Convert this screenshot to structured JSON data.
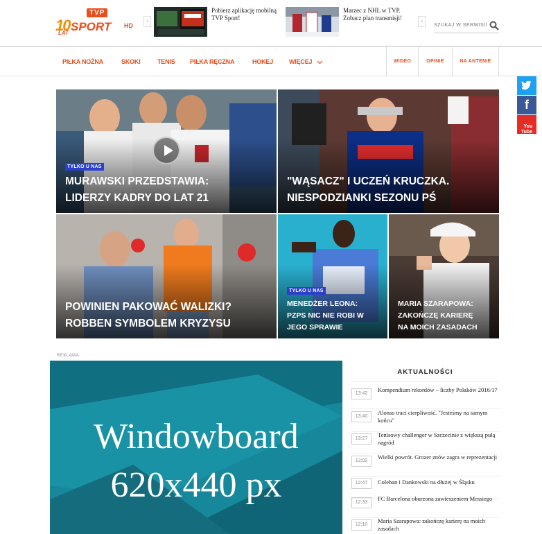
{
  "brand": {
    "tvp": "TVP",
    "ten": "10",
    "sport": "SPORT",
    "hd": "HD",
    "lat": "LAT",
    "tvp_color": "#e94e1b"
  },
  "promos": [
    {
      "text": "Pobierz aplikację mobilną TVP Sport!",
      "icon": "tv-app-thumbnail"
    },
    {
      "text": "Marzec z NHL w TVP. Zobacz plan transmisji!",
      "icon": "hockey-thumbnail"
    }
  ],
  "search": {
    "placeholder": "SZUKAJ W SERWISIE",
    "icon": "search-icon"
  },
  "nav": {
    "items": [
      "PIŁKA NOŻNA",
      "SKOKI",
      "TENIS",
      "PIŁKA RĘCZNA",
      "HOKEJ",
      "WIĘCEJ"
    ],
    "more_icon": "chevron-down-icon",
    "right": [
      "WIDEO",
      "OPINIE",
      "NA ANTENIE"
    ]
  },
  "social": [
    {
      "name": "twitter",
      "glyph": "t",
      "color": "#1da1f2"
    },
    {
      "name": "facebook",
      "glyph": "f",
      "color": "#3b5998"
    },
    {
      "name": "youtube",
      "glyph": "You\nTube",
      "color": "#e52d27"
    }
  ],
  "tiles": [
    {
      "badge": "TYLKO U NAS",
      "title": "MURAWSKI PRZEDSTAWIA: LIDERZY KADRY DO LAT 21",
      "line1": "MURAWSKI PRZEDSTAWIA:",
      "line2": "LIDERZY KADRY DO LAT 21",
      "has_video": true
    },
    {
      "badge": "",
      "line1": "\"WĄSACZ\" I UCZEŃ KRUCZKA.",
      "line2": "NIESPODZIANKI SEZONU PŚ"
    },
    {
      "badge": "",
      "line1": "POWINIEN PAKOWAĆ WALIZKI?",
      "line2": "ROBBEN SYMBOLEM KRYZYSU"
    },
    {
      "badge": "TYLKO U NAS",
      "line1": "MENEDŻER LEONA:",
      "line2": "PZPS NIC NIE ROBI W",
      "line3": "JEGO SPRAWIE"
    },
    {
      "badge": "",
      "line1": "MARIA SZARAPOWA:",
      "line2": "ZAKOŃCZĘ KARIERĘ",
      "line3": "NA MOICH ZASADACH"
    }
  ],
  "ad": {
    "label": "REKLAMA",
    "line1": "Windowboard",
    "line2": "620x440 px"
  },
  "news": {
    "title": "AKTUALNOŚCI",
    "items": [
      {
        "time": "13:42",
        "text": "Kompendium rekordów – liczby Polaków 2016/17"
      },
      {
        "time": "13:40",
        "text": "Alonso traci cierpliwość. \"Jesteśmy na samym końcu\""
      },
      {
        "time": "13:27",
        "text": "Tenisowy challenger w Szczecinie z większą pulą nagród"
      },
      {
        "time": "13:02",
        "text": "Wielki powrót. Grozer znów zagra w reprezentacji"
      },
      {
        "time": "12:47",
        "text": "Coleban i Dankowski na dłużej w Śląsku"
      },
      {
        "time": "12:33",
        "text": "FC Barcelona oburzona zawieszeniem Messiego"
      },
      {
        "time": "12:10",
        "text": "Maria Szarapowa: zakończę karierę na moich zasadach"
      }
    ]
  }
}
